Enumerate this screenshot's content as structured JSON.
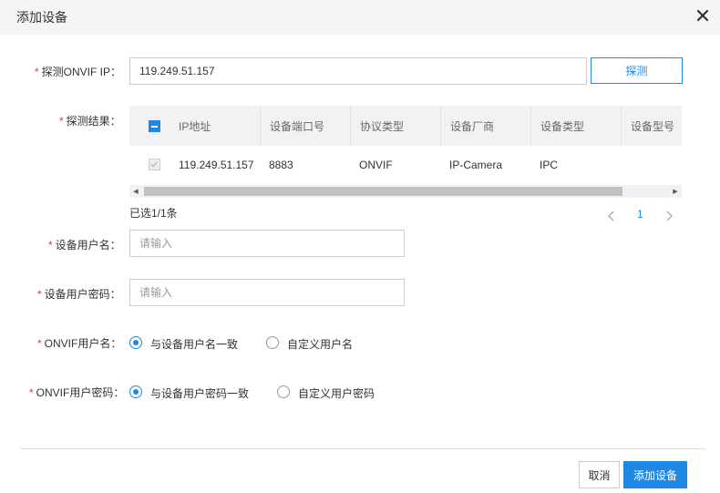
{
  "dialog": {
    "title": "添加设备",
    "close_icon": "close-icon"
  },
  "form": {
    "probe_ip": {
      "required_mark": "*",
      "label": "探测ONVIF IP：",
      "value": "119.249.51.157",
      "button_label": "探测"
    },
    "probe_result": {
      "required_mark": "*",
      "label": "探测结果："
    },
    "device_username": {
      "required_mark": "*",
      "label": "设备用户名：",
      "placeholder": "请输入"
    },
    "device_password": {
      "required_mark": "*",
      "label": "设备用户密码：",
      "placeholder": "请输入"
    },
    "onvif_username": {
      "required_mark": "*",
      "label": "ONVIF用户名：",
      "options": [
        "与设备用户名一致",
        "自定义用户名"
      ],
      "selected_index": 0
    },
    "onvif_password": {
      "required_mark": "*",
      "label": "ONVIF用户密码：",
      "options": [
        "与设备用户密码一致",
        "自定义用户密码"
      ],
      "selected_index": 0
    }
  },
  "table": {
    "columns": [
      "IP地址",
      "设备端口号",
      "协议类型",
      "设备厂商",
      "设备类型",
      "设备型号"
    ],
    "rows": [
      {
        "ip": "119.249.51.157",
        "port": "8883",
        "protocol": "ONVIF",
        "vendor": "IP-Camera",
        "type": "IPC",
        "model": ""
      }
    ],
    "selected_text": "已选1/1条",
    "pagination": {
      "current_page": "1"
    }
  },
  "footer": {
    "cancel_label": "取消",
    "submit_label": "添加设备"
  },
  "colors": {
    "primary": "#1e88e5",
    "required": "#e4393c"
  }
}
